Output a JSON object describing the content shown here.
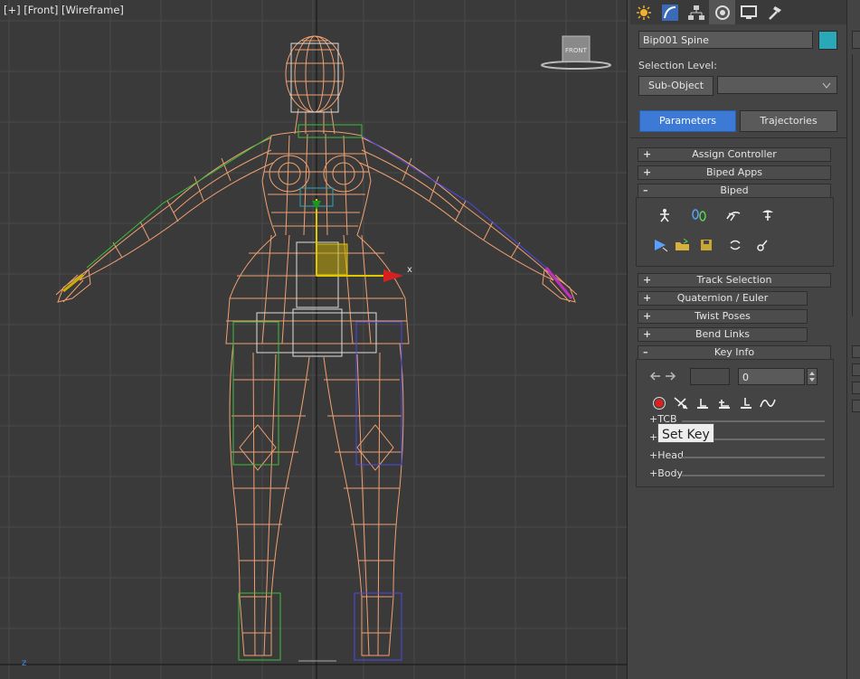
{
  "viewport": {
    "label_plus": "[+]",
    "label_view": "[Front]",
    "label_mode": "[Wireframe]",
    "viewcube_label": "FRONT",
    "gizmo_axis": "x",
    "corner_axis": "z"
  },
  "command_panel": {
    "tabs": [
      {
        "icon": "create-icon"
      },
      {
        "icon": "modify-icon"
      },
      {
        "icon": "hierarchy-icon"
      },
      {
        "icon": "motion-icon"
      },
      {
        "icon": "display-icon"
      },
      {
        "icon": "utilities-icon"
      }
    ],
    "object_name": "Bip001 Spine",
    "object_color": "#2aa8b8",
    "selection_level_label": "Selection Level:",
    "sub_object_button": "Sub-Object",
    "sub_object_dropdown": "",
    "parameters_tab": "Parameters",
    "trajectories_tab": "Trajectories"
  },
  "rollouts": {
    "assign_controller": "Assign Controller",
    "biped_apps": "Biped Apps",
    "biped": "Biped",
    "track_selection": "Track Selection",
    "quaternion_euler": "Quaternion / Euler",
    "twist_poses": "Twist Poses",
    "bend_links": "Bend Links",
    "key_info": "Key Info",
    "plus": "+",
    "minus": "–"
  },
  "key_info": {
    "key_number": "",
    "time_value": "0",
    "sub_rows": [
      "+TCB",
      "+IK",
      "+Head",
      "+Body"
    ]
  },
  "tooltip": {
    "text": "Set Key"
  }
}
